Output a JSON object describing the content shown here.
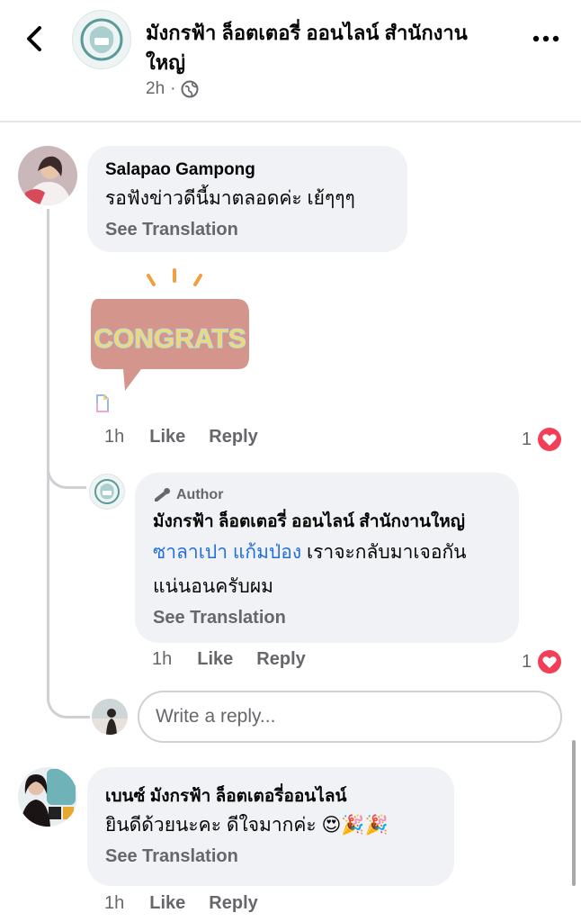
{
  "header": {
    "title": "มังกรฟ้า ล็อตเตอรี่ ออนไลน์ สำนักงานใหญ่",
    "time": "2h",
    "privacy_icon": "globe-icon"
  },
  "comments": [
    {
      "author": "Salapao Gampong",
      "text": "รอฟังข่าวดีนี้มาตลอดค่ะ เย้ๆๆๆ",
      "see_translation": "See Translation",
      "sticker_text": "CONGRATS",
      "time": "1h",
      "like": "Like",
      "reply": "Reply",
      "reaction_count": "1",
      "reaction_icon": "heart-icon",
      "replies": [
        {
          "badge": "Author",
          "author": "มังกรฟ้า ล็อตเตอรี่ ออนไลน์ สำนักงานใหญ่",
          "mention": "ซาลาเปา แก้มป่อง",
          "text_after_mention": " เราจะกลับมาเจอกัน",
          "text_line2": "แน่นอนครับผม",
          "see_translation": "See Translation",
          "time": "1h",
          "like": "Like",
          "reply": "Reply",
          "reaction_count": "1",
          "reaction_icon": "heart-icon"
        }
      ],
      "reply_placeholder": "Write a reply..."
    },
    {
      "author": "เบนซ์ มังกรฟ้า ล็อตเตอรี่ออนไลน์",
      "text": "ยินดีด้วยนะคะ ดีใจมากค่ะ 😍🎉🎉",
      "see_translation": "See Translation",
      "time": "1h",
      "like": "Like",
      "reply": "Reply"
    }
  ],
  "colors": {
    "bubble": "#f0f2f5",
    "secondary_text": "#65676b",
    "mention": "#216fdb",
    "heart": "#f33e58"
  }
}
